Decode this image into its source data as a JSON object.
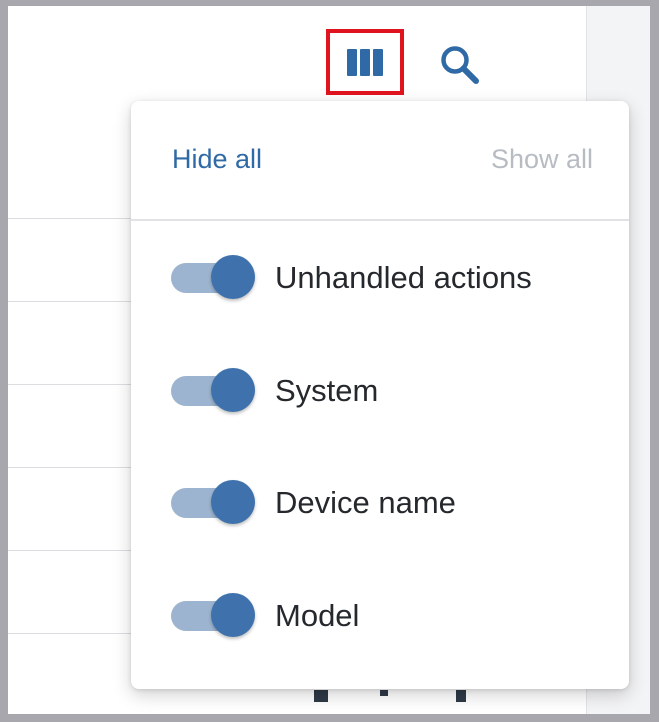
{
  "toolbar": {
    "columns_icon": "view-columns-icon",
    "search_icon": "search-icon",
    "accent_color": "#2f6aa6",
    "highlight_color": "#e0141e"
  },
  "column_menu": {
    "hide_all_label": "Hide all",
    "show_all_label": "Show all",
    "items": [
      {
        "label": "Unhandled actions",
        "enabled": true
      },
      {
        "label": "System",
        "enabled": true
      },
      {
        "label": "Device name",
        "enabled": true
      },
      {
        "label": "Model",
        "enabled": true
      }
    ]
  }
}
